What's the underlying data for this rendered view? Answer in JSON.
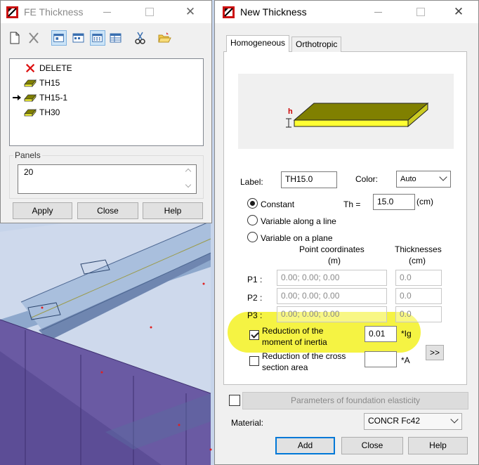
{
  "fe_window": {
    "title": "FE Thickness",
    "list_items": [
      "DELETE",
      "TH15",
      "TH15-1",
      "TH30"
    ],
    "panels_label": "Panels",
    "panels_value": "20",
    "buttons": {
      "apply": "Apply",
      "close": "Close",
      "help": "Help"
    }
  },
  "nt_window": {
    "title": "New Thickness",
    "tabs": [
      "Homogeneous",
      "Orthotropic"
    ],
    "preview_h": "h",
    "label_caption": "Label:",
    "label_value": "TH15.0",
    "color_caption": "Color:",
    "color_value": "Auto",
    "radio_constant": "Constant",
    "radio_variable_line": "Variable along a line",
    "radio_variable_plane": "Variable on a plane",
    "th_caption": "Th =",
    "th_value": "15.0",
    "th_unit": "(cm)",
    "point_coords_header": "Point coordinates",
    "point_coords_unit": "(m)",
    "thicknesses_header": "Thicknesses",
    "thicknesses_unit": "(cm)",
    "points": [
      {
        "label": "P1 :",
        "coords": "0.00; 0.00; 0.00",
        "thickness": "0.0"
      },
      {
        "label": "P2 :",
        "coords": "0.00; 0.00; 0.00",
        "thickness": "0.0"
      },
      {
        "label": "P3 :",
        "coords": "0.00; 0.00; 0.00",
        "thickness": "0.0"
      }
    ],
    "reduction_inertia_line1": "Reduction of the",
    "reduction_inertia_line2": "moment of inertia",
    "reduction_inertia_value": "0.01",
    "reduction_inertia_unit": "*Ig",
    "reduction_cross_line1": "Reduction of the cross",
    "reduction_cross_line2": "section area",
    "reduction_cross_value": "",
    "reduction_cross_unit": "*A",
    "more_button": ">>",
    "foundation_button": "Parameters of foundation elasticity",
    "material_caption": "Material:",
    "material_value": "CONCR Fc42",
    "buttons": {
      "add": "Add",
      "close": "Close",
      "help": "Help"
    }
  },
  "colors": {
    "highlight": "#f4f233",
    "slab_top": "#808000",
    "slab_edge": "#ffff33",
    "delete_icon": "#d11",
    "focus_blue": "#0078d7"
  }
}
